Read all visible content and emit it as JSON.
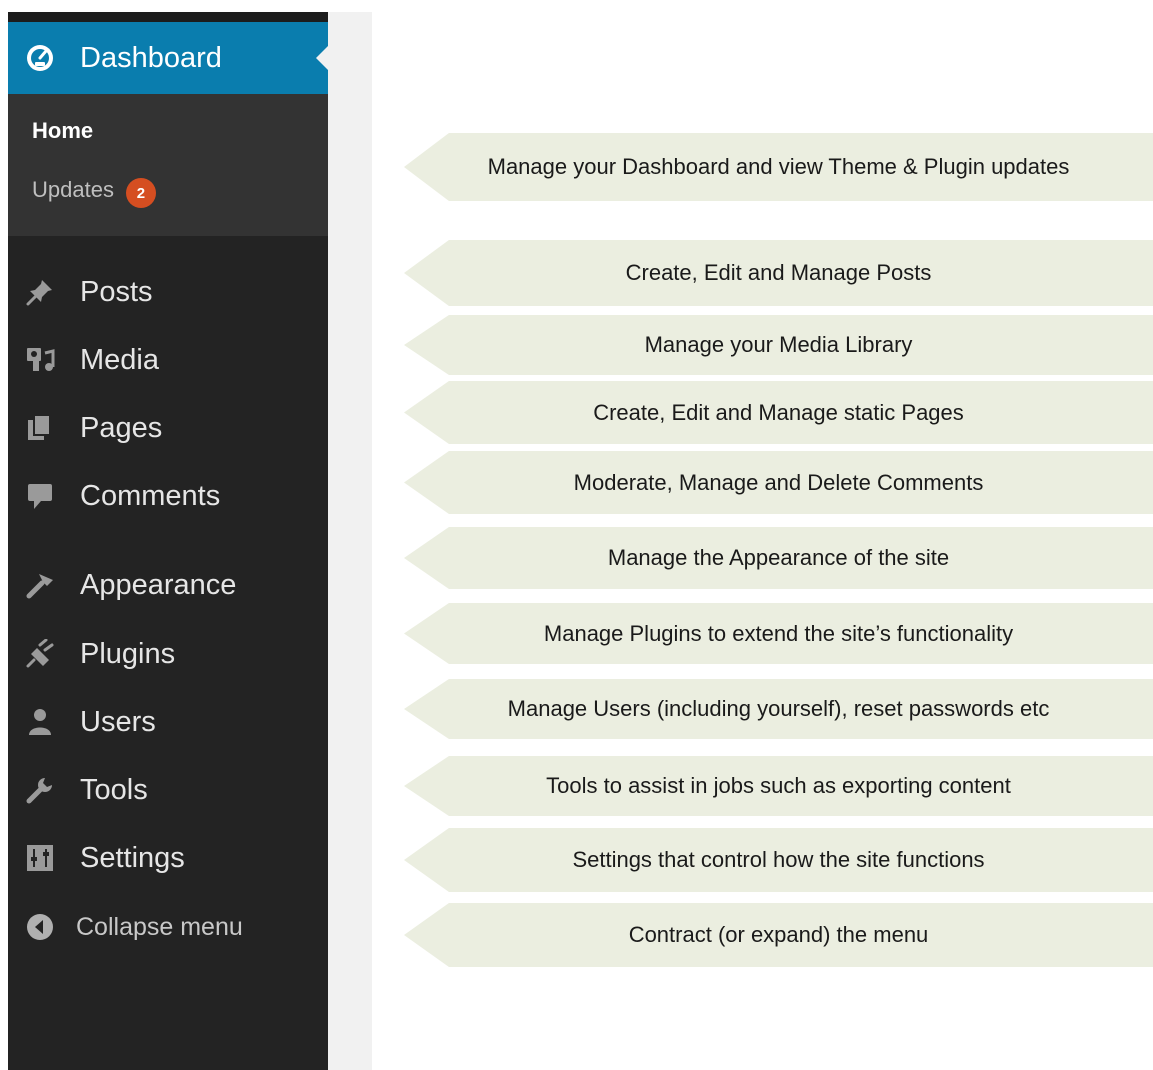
{
  "sidebar": {
    "dashboard": {
      "label": "Dashboard",
      "icon": "dashboard-icon"
    },
    "submenu": {
      "home": "Home",
      "updates": "Updates",
      "updates_count": "2"
    },
    "items": [
      {
        "label": "Posts",
        "icon": "pin-icon"
      },
      {
        "label": "Media",
        "icon": "media-icon"
      },
      {
        "label": "Pages",
        "icon": "pages-icon"
      },
      {
        "label": "Comments",
        "icon": "comment-icon"
      },
      {
        "label": "Appearance",
        "icon": "paintbrush-icon"
      },
      {
        "label": "Plugins",
        "icon": "plugin-icon"
      },
      {
        "label": "Users",
        "icon": "users-icon"
      },
      {
        "label": "Tools",
        "icon": "wrench-icon"
      },
      {
        "label": "Settings",
        "icon": "settings-icon"
      }
    ],
    "collapse": {
      "label": "Collapse menu",
      "icon": "collapse-arrow-icon"
    }
  },
  "callouts": [
    "Manage your Dashboard and view Theme & Plugin updates",
    "Create, Edit and Manage Posts",
    "Manage your Media Library",
    "Create, Edit and Manage static Pages",
    "Moderate, Manage and Delete Comments",
    "Manage the Appearance of the site",
    "Manage Plugins to extend the site’s functionality",
    "Manage Users (including yourself), reset passwords etc",
    "Tools to assist in jobs such as exporting content",
    "Settings that control how the site functions",
    "Contract (or expand) the menu"
  ],
  "colors": {
    "sidebar_bg": "#232323",
    "submenu_bg": "#333333",
    "active_bg": "#0a7dae",
    "badge": "#d54e21",
    "callout_bg": "#ebeee0"
  }
}
